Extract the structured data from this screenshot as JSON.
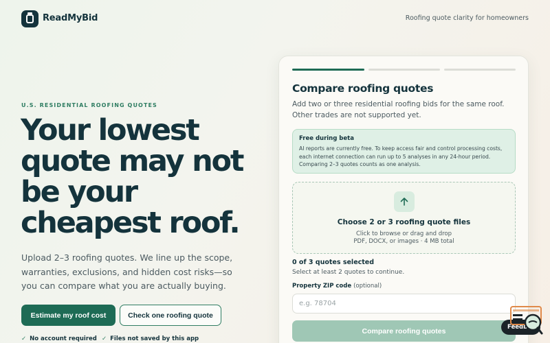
{
  "header": {
    "brand": "ReadMyBid",
    "tagline": "Roofing quote clarity for homeowners"
  },
  "hero": {
    "eyebrow": "U.S. RESIDENTIAL ROOFING QUOTES",
    "headline_lines": [
      "Your lowest",
      "quote may not",
      "be your",
      "cheapest roof."
    ],
    "subcopy": "Upload 2–3 roofing quotes. We line up the scope, warranties, exclusions, and hidden cost risks—so you can compare what you are actually buying.",
    "primary_cta": "Estimate my roof cost",
    "secondary_cta": "Check one roofing quote",
    "notes": [
      "No account required",
      "Files not saved by this app"
    ]
  },
  "card": {
    "steps_total": 3,
    "step_current": 1,
    "title": "Compare roofing quotes",
    "description": "Add two or three residential roofing bids for the same roof. Other trades are not supported yet.",
    "beta_title": "Free during beta",
    "beta_text": "AI reports are currently free. To keep access fair and control processing costs, each internet connection can run up to 5 analyses in any 24-hour period. Comparing 2–3 quotes counts as one analysis.",
    "dropzone_title": "Choose 2 or 3 roofing quote files",
    "dropzone_hint": "Click to browse or drag and drop",
    "dropzone_formats": "PDF, DOCX, or images · 4 MB total",
    "selected_count": "0 of 3 quotes selected",
    "selected_hint": "Select at least 2 quotes to continue.",
    "zip_label": "Property ZIP code",
    "zip_optional": "(optional)",
    "zip_placeholder": "e.g. 78704",
    "zip_value": "",
    "submit_label": "Compare roofing quotes"
  },
  "feedback": {
    "label": "Feedb"
  },
  "colors": {
    "accent": "#1e6b55",
    "ink": "#14333c",
    "beta_bg": "#dff0e6",
    "submit_disabled": "#9fc7b5"
  },
  "icons": {
    "logo": "document-icon",
    "upload": "arrow-up-icon",
    "check": "check-icon",
    "feedback": "chat-feedback-icon"
  }
}
